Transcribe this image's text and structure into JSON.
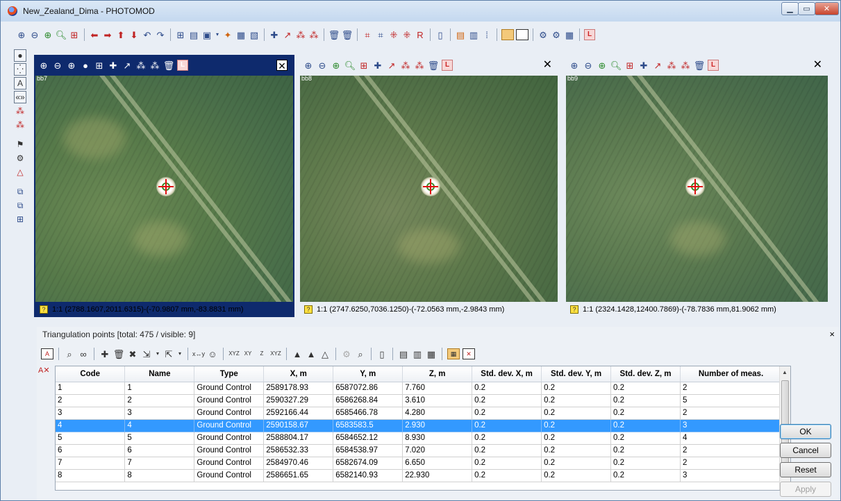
{
  "window": {
    "title": "New_Zealand_Dima - PHOTOMOD"
  },
  "main_toolbar": {
    "icons": [
      "zoom-in-icon",
      "zoom-out-icon",
      "zoom-fit-icon",
      "zoom-icon",
      "cross-target-icon",
      "arrow-left-icon",
      "arrow-right-icon",
      "arrow-up-icon",
      "arrow-down-icon",
      "undo-icon",
      "redo-icon",
      "grid-icon",
      "layout-icon",
      "screen-icon",
      "lightning-icon",
      "stack-icon",
      "image-icon",
      "add-point-icon",
      "measure-point-icon",
      "points-icon",
      "points-alt-icon",
      "delete-point-icon",
      "delete-points-icon",
      "matrix-icon",
      "matrix-alt-icon",
      "table-icon",
      "table-alt-icon",
      "report-icon",
      "document-icon",
      "panel-icon",
      "panel-alt-icon",
      "panel-dots-icon",
      "single-window-icon",
      "dual-window-icon",
      "settings-icon",
      "settings-alt-icon",
      "run-icon",
      "l-icon"
    ]
  },
  "panes": [
    {
      "corner_label": "bb7",
      "status": "1:1 (2788.1607,2011.6315)-(-70.9807 mm,-83.8831 mm)",
      "active": true
    },
    {
      "corner_label": "bb8",
      "status": "1:1 (2747.6250,7036.1250)-(-72.0563 mm,-2.9843 mm)",
      "active": false
    },
    {
      "corner_label": "bb9",
      "status": "1:1 (2324.1428,12400.7869)-(-78.7836 mm,81.9062 mm)",
      "active": false
    }
  ],
  "triangulation": {
    "header": "Triangulation points [total: 475 / visible: 9]",
    "close": "×",
    "columns": [
      "Code",
      "Name",
      "Type",
      "X, m",
      "Y, m",
      "Z, m",
      "Std. dev. X, m",
      "Std. dev. Y, m",
      "Std. dev. Z, m",
      "Number of meas."
    ],
    "rows": [
      [
        "1",
        "1",
        "Ground Control",
        "2589178.93",
        "6587072.86",
        "7.760",
        "0.2",
        "0.2",
        "0.2",
        "2"
      ],
      [
        "2",
        "2",
        "Ground Control",
        "2590327.29",
        "6586268.84",
        "3.610",
        "0.2",
        "0.2",
        "0.2",
        "5"
      ],
      [
        "3",
        "3",
        "Ground Control",
        "2592166.44",
        "6585466.78",
        "4.280",
        "0.2",
        "0.2",
        "0.2",
        "2"
      ],
      [
        "4",
        "4",
        "Ground Control",
        "2590158.67",
        "6583583.5",
        "2.930",
        "0.2",
        "0.2",
        "0.2",
        "3"
      ],
      [
        "5",
        "5",
        "Ground Control",
        "2588804.17",
        "6584652.12",
        "8.930",
        "0.2",
        "0.2",
        "0.2",
        "4"
      ],
      [
        "6",
        "6",
        "Ground Control",
        "2586532.33",
        "6584538.97",
        "7.020",
        "0.2",
        "0.2",
        "0.2",
        "2"
      ],
      [
        "7",
        "7",
        "Ground Control",
        "2584970.46",
        "6582674.09",
        "6.650",
        "0.2",
        "0.2",
        "0.2",
        "2"
      ],
      [
        "8",
        "8",
        "Ground Control",
        "2586651.65",
        "6582140.93",
        "22.930",
        "0.2",
        "0.2",
        "0.2",
        "3"
      ]
    ],
    "selected_row": 3,
    "buttons": {
      "ok": "OK",
      "cancel": "Cancel",
      "reset": "Reset",
      "apply": "Apply"
    }
  },
  "colors": {
    "active_pane": "#0e2a6d",
    "selection": "#3399ff",
    "target_cross": "#e01010"
  }
}
